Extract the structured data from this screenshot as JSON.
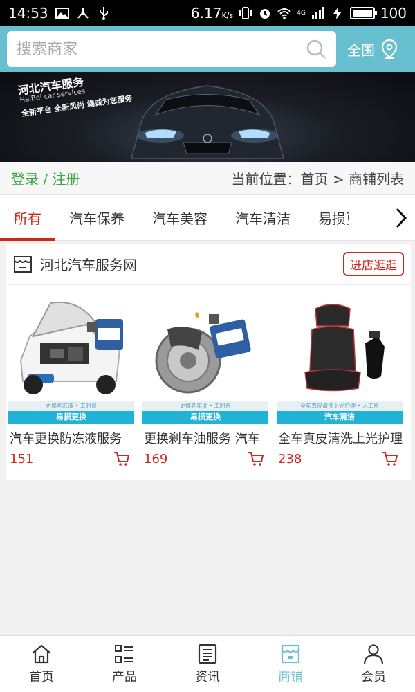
{
  "status_bar": {
    "time": "14:53",
    "speed": "6.17",
    "speed_unit": "K/s",
    "network": "4G",
    "battery": "100"
  },
  "search": {
    "placeholder": "搜索商家",
    "region_label": "全国"
  },
  "banner": {
    "title": "河北汽车服务",
    "subtitle": "HeiBei car services",
    "slogan": "全新平台  全新风尚  竭诚为您服务"
  },
  "location_bar": {
    "login_text": "登录 / 注册",
    "breadcrumb": "当前位置：首页 > 商铺列表"
  },
  "tabs": [
    {
      "label": "所有",
      "active": true
    },
    {
      "label": "汽车保养"
    },
    {
      "label": "汽车美容"
    },
    {
      "label": "汽车清洁"
    },
    {
      "label": "易损更"
    }
  ],
  "shop": {
    "name": "河北汽车服务网",
    "visit_label": "进店逛逛",
    "products": [
      {
        "caption": "更换防冻液 • 工时费",
        "tag": "易损更换",
        "name": "汽车更换防冻液服务",
        "price": "151"
      },
      {
        "caption": "更换刹车油 • 工时费",
        "tag": "易损更换",
        "name": "更换刹车油服务 汽车",
        "price": "169"
      },
      {
        "caption": "全车真皮清洗上光护理 • 人工费",
        "tag": "汽车清洁",
        "name": "全车真皮清洗上光护理",
        "price": "238"
      }
    ]
  },
  "bottom_nav": [
    {
      "label": "首页",
      "icon": "home-icon"
    },
    {
      "label": "产品",
      "icon": "list-icon"
    },
    {
      "label": "资讯",
      "icon": "news-icon"
    },
    {
      "label": "商铺",
      "icon": "store-icon",
      "active": true
    },
    {
      "label": "会员",
      "icon": "user-icon"
    }
  ],
  "colors": {
    "header": "#67bfcf",
    "accent_red": "#d0271b",
    "login_green": "#3aa840",
    "tag_blue": "#21b3d6",
    "nav_active": "#6cc0d2"
  }
}
